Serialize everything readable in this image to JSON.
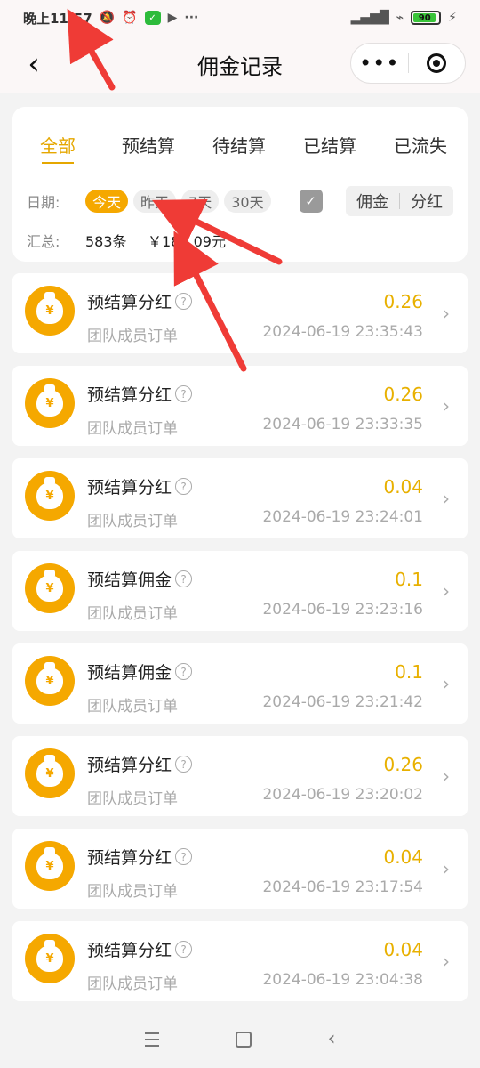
{
  "status_bar": {
    "time": "晚上11:57",
    "battery": "90"
  },
  "header": {
    "title": "佣金记录"
  },
  "filters": {
    "tabs": [
      "全部",
      "预结算",
      "待结算",
      "已结算",
      "已流失"
    ],
    "date_label": "日期:",
    "date_options": [
      "今天",
      "昨天",
      "7天",
      "30天"
    ],
    "type_options": [
      "佣金",
      "分红"
    ],
    "summary_label": "汇总:",
    "summary_count": "583条",
    "summary_amount": "￥181.09元"
  },
  "records": [
    {
      "title": "预结算分红",
      "desc": "团队成员订单",
      "amount": "0.26",
      "time": "2024-06-19 23:35:43"
    },
    {
      "title": "预结算分红",
      "desc": "团队成员订单",
      "amount": "0.26",
      "time": "2024-06-19 23:33:35"
    },
    {
      "title": "预结算分红",
      "desc": "团队成员订单",
      "amount": "0.04",
      "time": "2024-06-19 23:24:01"
    },
    {
      "title": "预结算佣金",
      "desc": "团队成员订单",
      "amount": "0.1",
      "time": "2024-06-19 23:23:16"
    },
    {
      "title": "预结算佣金",
      "desc": "团队成员订单",
      "amount": "0.1",
      "time": "2024-06-19 23:21:42"
    },
    {
      "title": "预结算分红",
      "desc": "团队成员订单",
      "amount": "0.26",
      "time": "2024-06-19 23:20:02"
    },
    {
      "title": "预结算分红",
      "desc": "团队成员订单",
      "amount": "0.04",
      "time": "2024-06-19 23:17:54"
    },
    {
      "title": "预结算分红",
      "desc": "团队成员订单",
      "amount": "0.04",
      "time": "2024-06-19 23:04:38"
    }
  ],
  "colors": {
    "accent": "#f5a800",
    "arrow": "#ef3b36"
  },
  "icons": {
    "back": "chevron-left-icon",
    "more": "more-dots-icon",
    "close": "target-icon",
    "calendar": "calendar-check-icon",
    "record": "money-bag-icon",
    "help": "question-circle-icon",
    "row_arrow": "chevron-right-icon"
  }
}
